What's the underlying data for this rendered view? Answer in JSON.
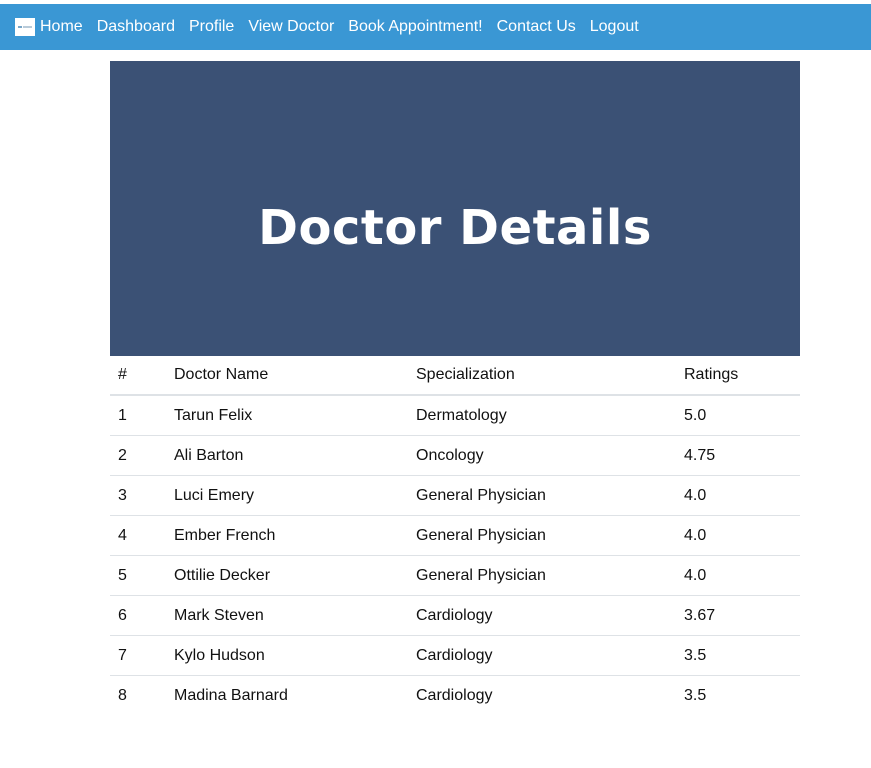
{
  "navbar": {
    "logo_icon": "brand-logo-icon",
    "links": [
      {
        "label": "Home"
      },
      {
        "label": "Dashboard"
      },
      {
        "label": "Profile"
      },
      {
        "label": "View Doctor"
      },
      {
        "label": "Book Appointment!"
      },
      {
        "label": "Contact Us"
      },
      {
        "label": "Logout"
      }
    ],
    "color": "#3a97d4"
  },
  "hero": {
    "title": "Doctor Details",
    "color": "#3b5175"
  },
  "table": {
    "headers": [
      "#",
      "Doctor Name",
      "Specialization",
      "Ratings"
    ],
    "rows": [
      [
        "1",
        "Tarun Felix",
        "Dermatology",
        "5.0"
      ],
      [
        "2",
        "Ali Barton",
        "Oncology",
        "4.75"
      ],
      [
        "3",
        "Luci Emery",
        "General Physician",
        "4.0"
      ],
      [
        "4",
        "Ember French",
        "General Physician",
        "4.0"
      ],
      [
        "5",
        "Ottilie Decker",
        "General Physician",
        "4.0"
      ],
      [
        "6",
        "Mark Steven",
        "Cardiology",
        "3.67"
      ],
      [
        "7",
        "Kylo Hudson",
        "Cardiology",
        "3.5"
      ],
      [
        "8",
        "Madina Barnard",
        "Cardiology",
        "3.5"
      ]
    ]
  }
}
